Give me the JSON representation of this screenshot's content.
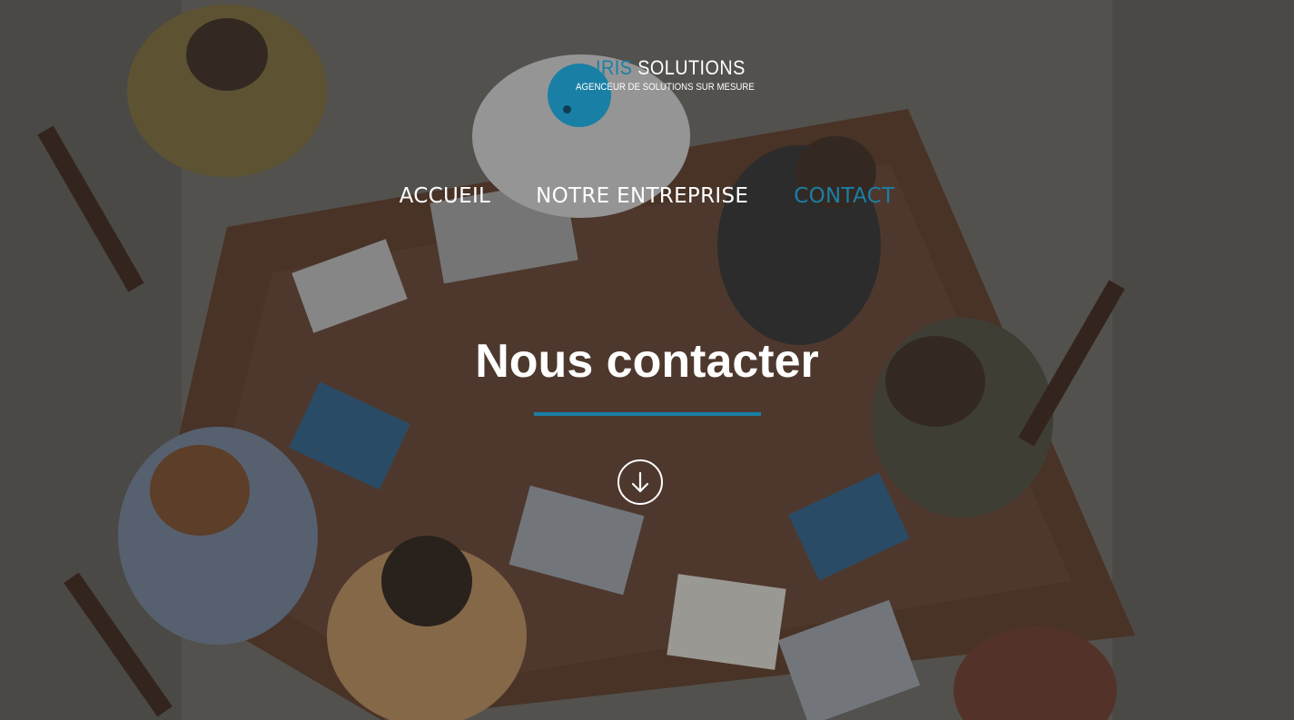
{
  "logo": {
    "brand_accent": "IRIS",
    "brand_rest": " SOLUTIONS",
    "tagline": "AGENCEUR DE SOLUTIONS SUR MESURE"
  },
  "nav": {
    "items": [
      {
        "label": "ACCUEIL",
        "active": false
      },
      {
        "label": "NOTRE ENTREPRISE",
        "active": false
      },
      {
        "label": "CONTACT",
        "active": true
      }
    ]
  },
  "hero": {
    "title": "Nous contacter",
    "scroll_icon": "arrow-down-circle-icon"
  },
  "colors": {
    "accent": "#1a7fa5",
    "text": "#ffffff",
    "overlay": "rgba(40,40,40,0.35)"
  }
}
